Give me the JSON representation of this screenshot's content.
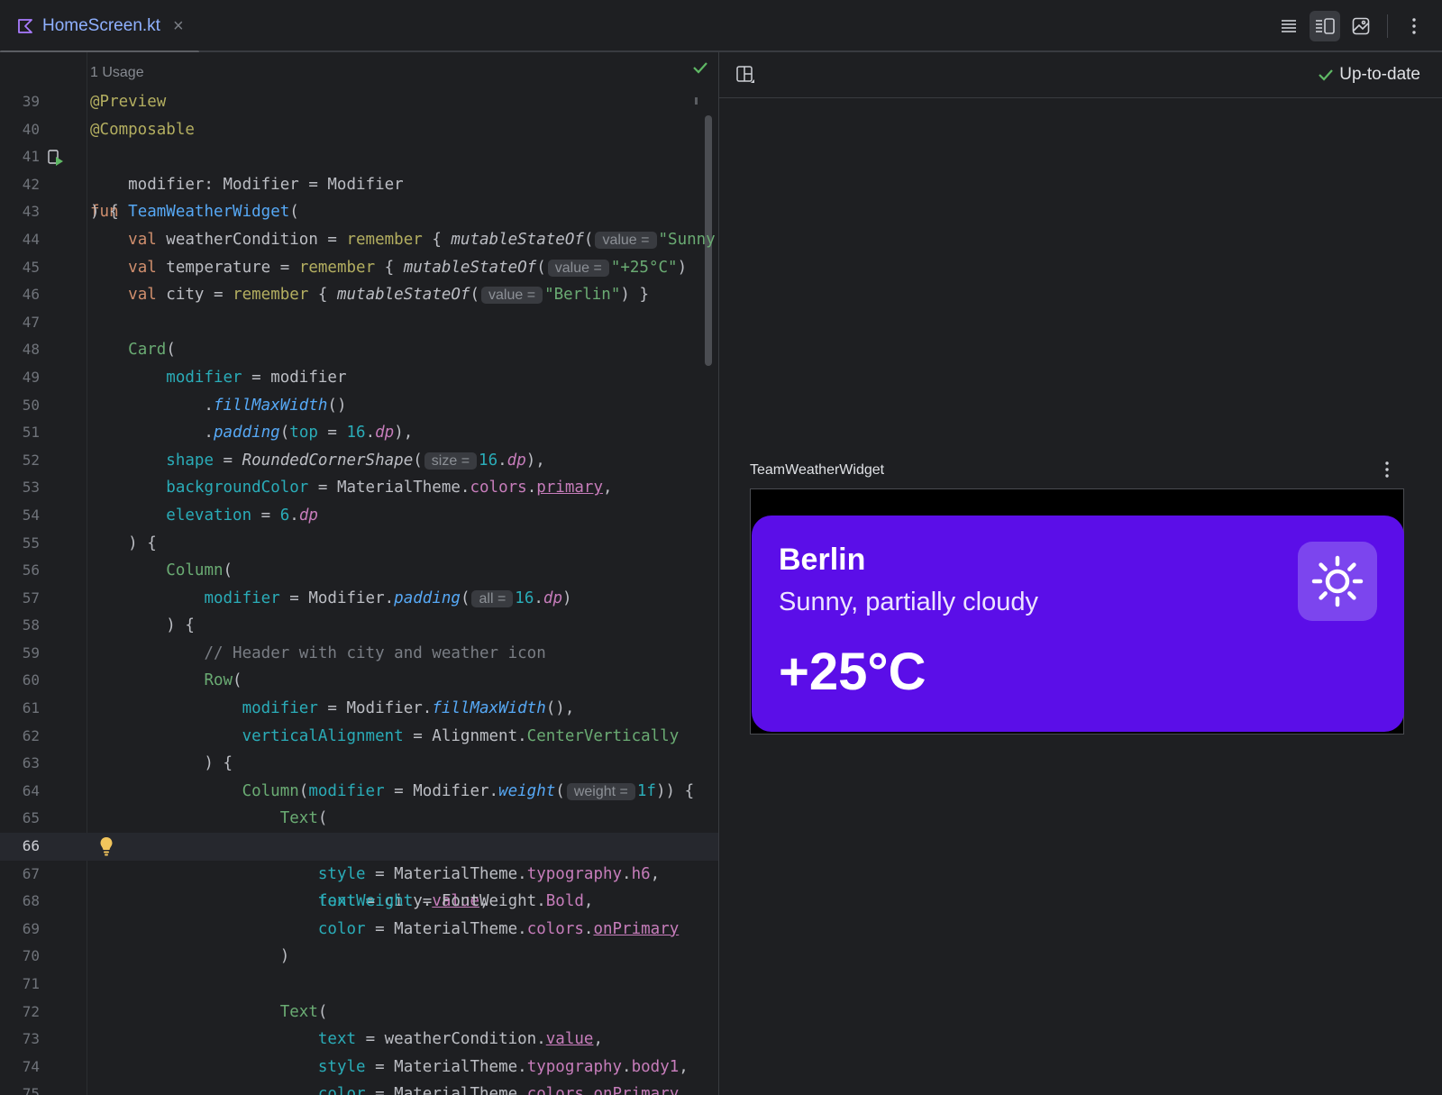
{
  "tab": {
    "filename": "HomeScreen.kt",
    "close": "×"
  },
  "editor": {
    "usage": "1 Usage",
    "lines": [
      "39",
      "40",
      "41",
      "42",
      "43",
      "44",
      "45",
      "46",
      "47",
      "48",
      "49",
      "50",
      "51",
      "52",
      "53",
      "54",
      "55",
      "56",
      "57",
      "58",
      "59",
      "60",
      "61",
      "62",
      "63",
      "64",
      "65",
      "66",
      "67",
      "68",
      "69",
      "70",
      "71",
      "72",
      "73",
      "74",
      "75"
    ],
    "current_line": "66"
  },
  "preview": {
    "status": "Up-to-date",
    "composable_name": "TeamWeatherWidget",
    "widget": {
      "city": "Berlin",
      "condition": "Sunny, partially cloudy",
      "temperature": "+25°C"
    }
  },
  "colors": {
    "card": "#5b0ee8",
    "card_icon_bg": "#7c45ee",
    "ok_green": "#5fb865"
  }
}
